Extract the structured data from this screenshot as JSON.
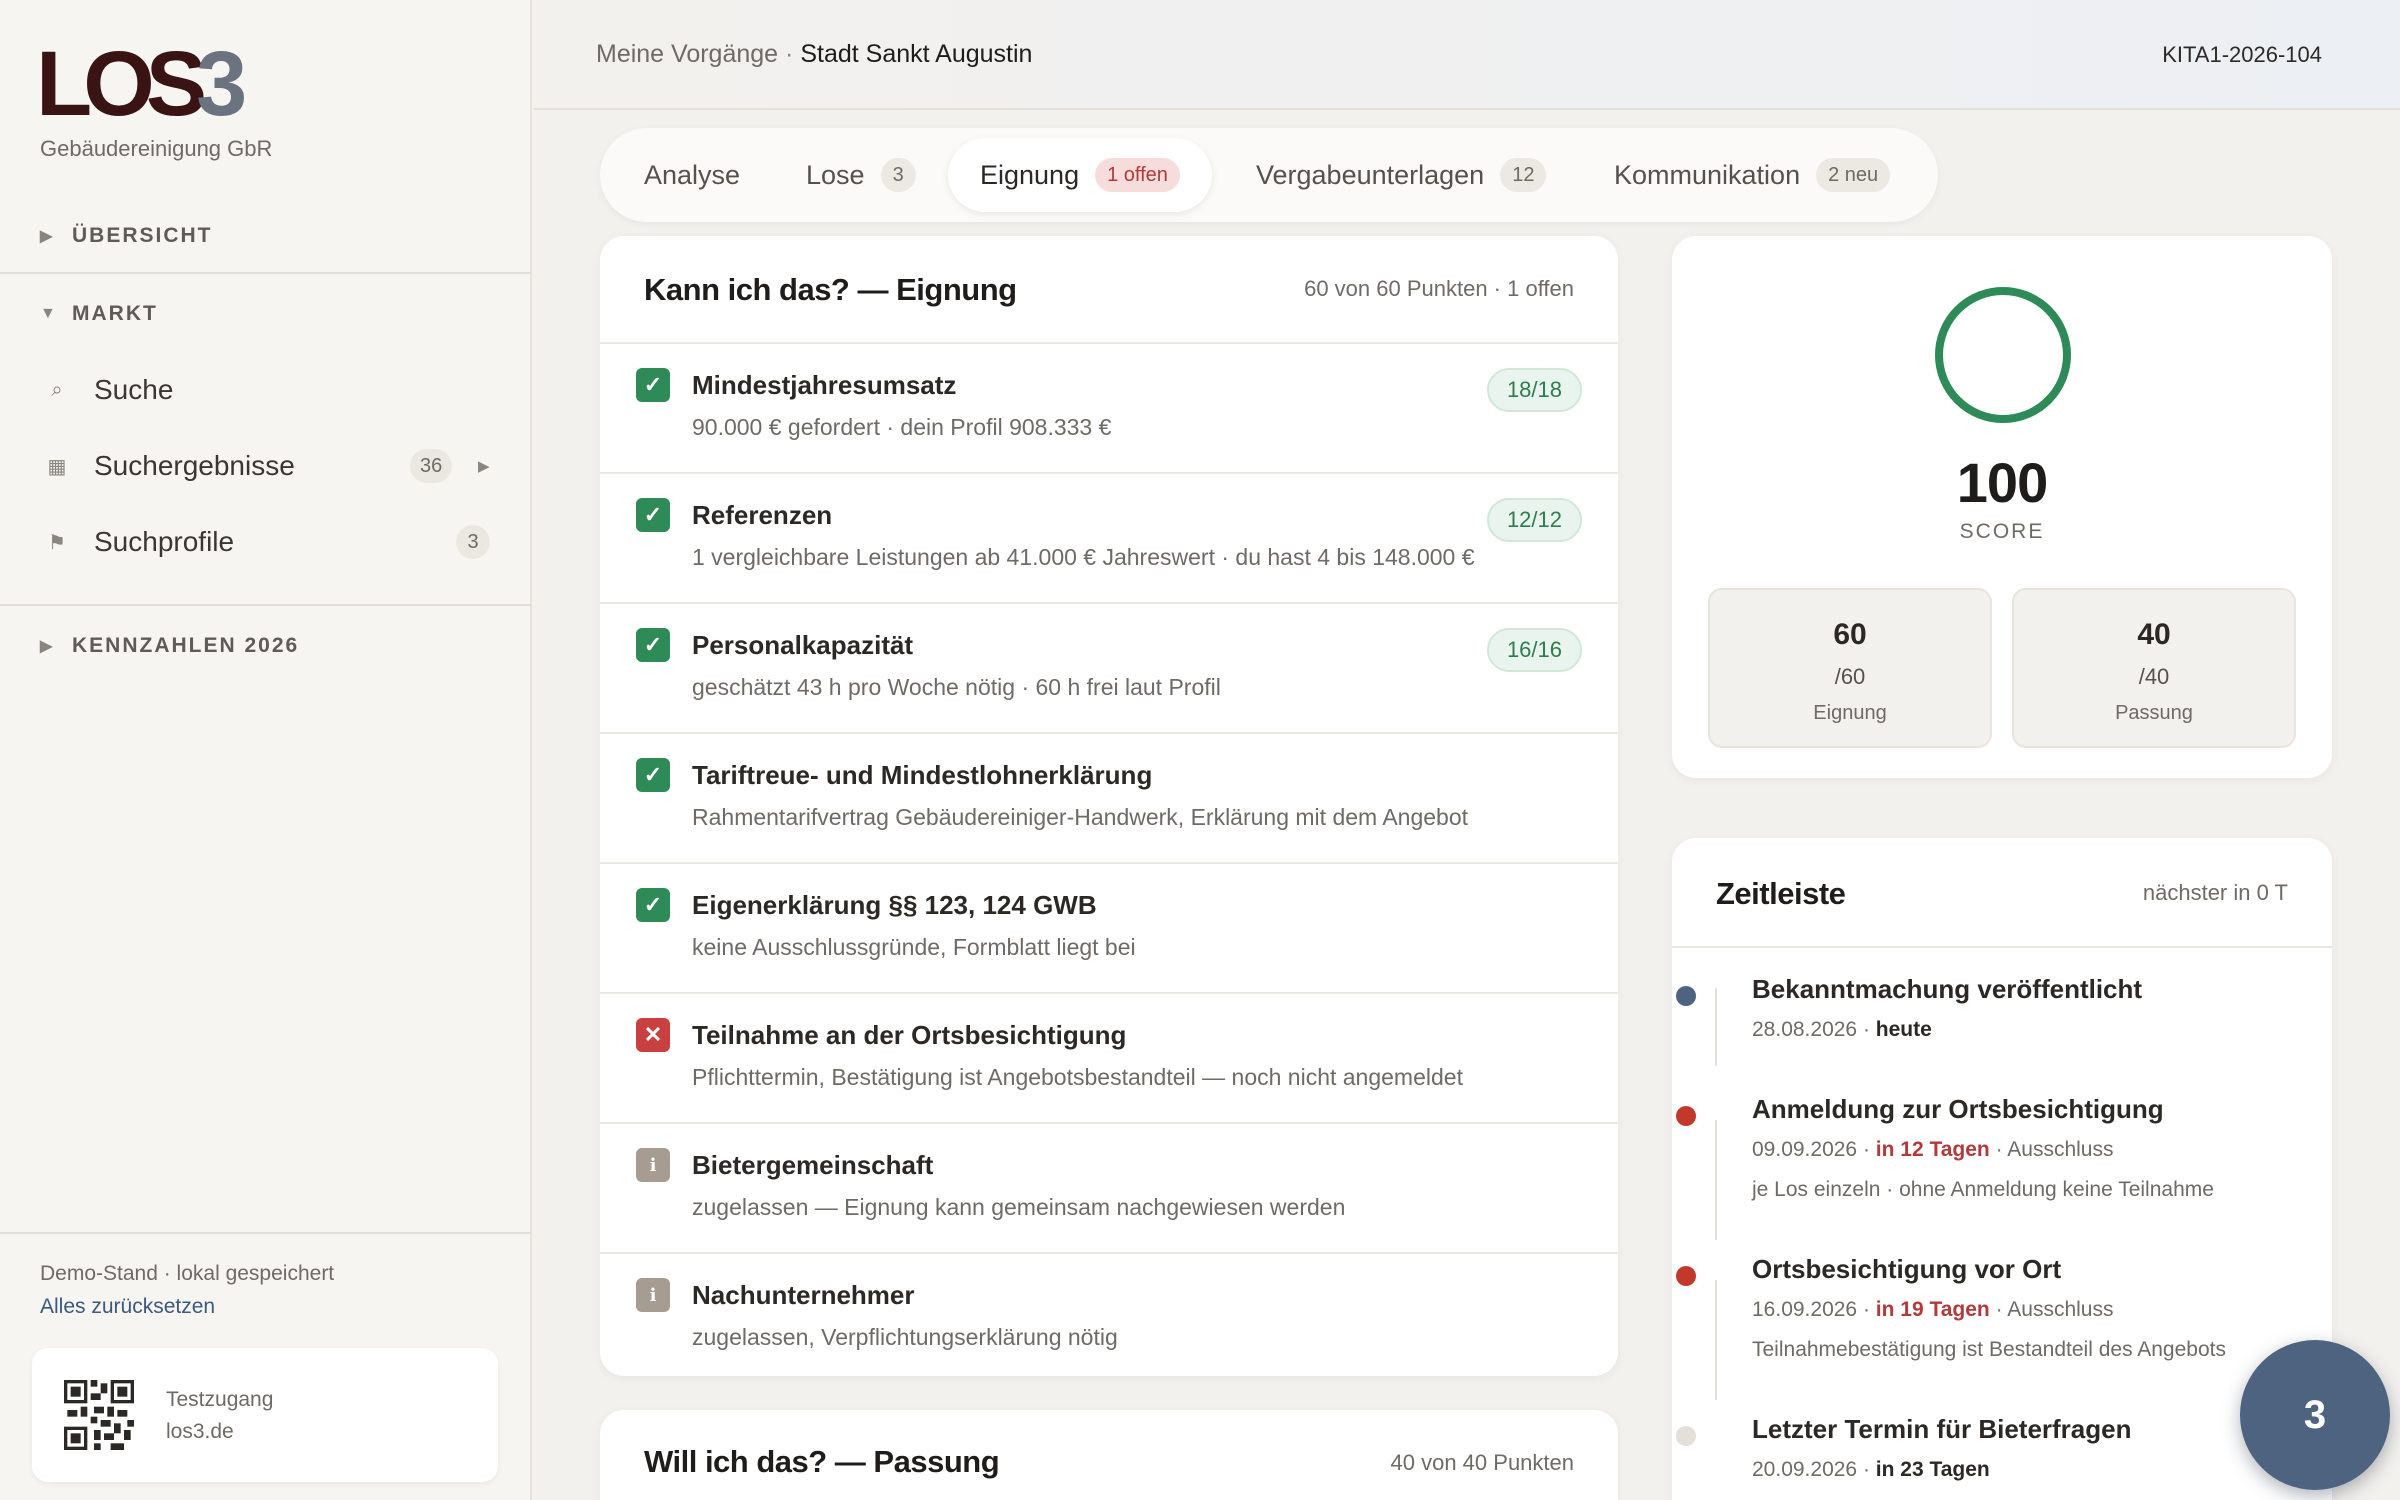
{
  "brand": {
    "logo_main": "LOS",
    "logo_num": "3",
    "company": "Gebäudereinigung GbR"
  },
  "sidebar": {
    "sections": [
      {
        "label": "ÜBERSICHT",
        "state": "collapsed"
      },
      {
        "label": "MARKT",
        "state": "expanded"
      },
      {
        "label": "KENNZAHLEN 2026",
        "state": "collapsed"
      }
    ],
    "items": [
      {
        "label": "Suche",
        "icon": "search-icon"
      },
      {
        "label": "Suchergebnisse",
        "icon": "grid-icon",
        "count": "36"
      },
      {
        "label": "Suchprofile",
        "icon": "flag-icon",
        "count": "3"
      }
    ],
    "footer": {
      "status": "Demo-Stand · lokal gespeichert",
      "reset": "Alles zurücksetzen",
      "qr_line1": "Testzugang",
      "qr_line2": "los3.de"
    }
  },
  "header": {
    "crumb_prefix": "Meine Vorgänge",
    "crumb_sep": "·",
    "crumb_current": "Stadt Sankt Augustin",
    "reference": "KITA1-2026-104"
  },
  "tabs": [
    {
      "label": "Analyse",
      "badge": ""
    },
    {
      "label": "Lose",
      "badge": "3"
    },
    {
      "label": "Eignung",
      "badge": "1 offen"
    },
    {
      "label": "Vergabeunterlagen",
      "badge": "12"
    },
    {
      "label": "Kommunikation",
      "badge": "2 neu"
    }
  ],
  "eignung": {
    "title": "Kann ich das? — Eignung",
    "meta": "60 von 60 Punkten · 1 offen",
    "rows": [
      {
        "status": "ok",
        "title": "Mindestjahresumsatz",
        "sub": "90.000 € gefordert · dein Profil 908.333 €",
        "points": "18/18"
      },
      {
        "status": "ok",
        "title": "Referenzen",
        "sub": "1 vergleichbare Leistungen ab 41.000 € Jahreswert · du hast 4 bis 148.000 €",
        "points": "12/12"
      },
      {
        "status": "ok",
        "title": "Personalkapazität",
        "sub": "geschätzt 43 h pro Woche nötig · 60 h frei laut Profil",
        "points": "16/16"
      },
      {
        "status": "ok",
        "title": "Tariftreue- und Mindestlohnerklärung",
        "sub": "Rahmentarifvertrag Gebäudereiniger-Handwerk, Erklärung mit dem Angebot",
        "points": ""
      },
      {
        "status": "ok",
        "title": "Eigenerklärung §§ 123, 124 GWB",
        "sub": "keine Ausschlussgründe, Formblatt liegt bei",
        "points": ""
      },
      {
        "status": "bad",
        "title": "Teilnahme an der Ortsbesichtigung",
        "sub": "Pflichttermin, Bestätigung ist Angebotsbestandteil — noch nicht angemeldet",
        "points": ""
      },
      {
        "status": "info",
        "title": "Bietergemeinschaft",
        "sub": "zugelassen — Eignung kann gemeinsam nachgewiesen werden",
        "points": ""
      },
      {
        "status": "info",
        "title": "Nachunternehmer",
        "sub": "zugelassen, Verpflichtungserklärung nötig",
        "points": ""
      }
    ]
  },
  "passung": {
    "title": "Will ich das? — Passung",
    "meta": "40 von 40 Punkten"
  },
  "score": {
    "value": "100",
    "label": "SCORE",
    "fraction": 1.0,
    "ring_color": "#2e8b57",
    "eignung": {
      "value": "60",
      "max": "/60",
      "label": "Eignung"
    },
    "passung": {
      "value": "40",
      "max": "/40",
      "label": "Passung"
    }
  },
  "timeline": {
    "title": "Zeitleiste",
    "meta": "nächster in 0 T",
    "items": [
      {
        "title": "Bekanntmachung veröffentlicht",
        "date": "28.08.2026",
        "rel": "heute",
        "rel_style": "hl",
        "tail": "",
        "note": "",
        "dot": "#4e6380"
      },
      {
        "title": "Anmeldung zur Ortsbesichtigung",
        "date": "09.09.2026",
        "rel": "in 12 Tagen",
        "rel_style": "red",
        "tail": "Ausschluss",
        "note": "je Los einzeln · ohne Anmeldung keine Teilnahme",
        "dot": "#c0392b"
      },
      {
        "title": "Ortsbesichtigung vor Ort",
        "date": "16.09.2026",
        "rel": "in 19 Tagen",
        "rel_style": "red",
        "tail": "Ausschluss",
        "note": "Teilnahmebestätigung ist Bestandteil des Angebots",
        "dot": "#c0392b"
      },
      {
        "title": "Letzter Termin für Bieterfragen",
        "date": "20.09.2026",
        "rel": "in 23 Tagen",
        "rel_style": "hl",
        "tail": "",
        "note": "",
        "dot": "#e3dfd9"
      }
    ]
  },
  "fab": {
    "label": "3"
  }
}
